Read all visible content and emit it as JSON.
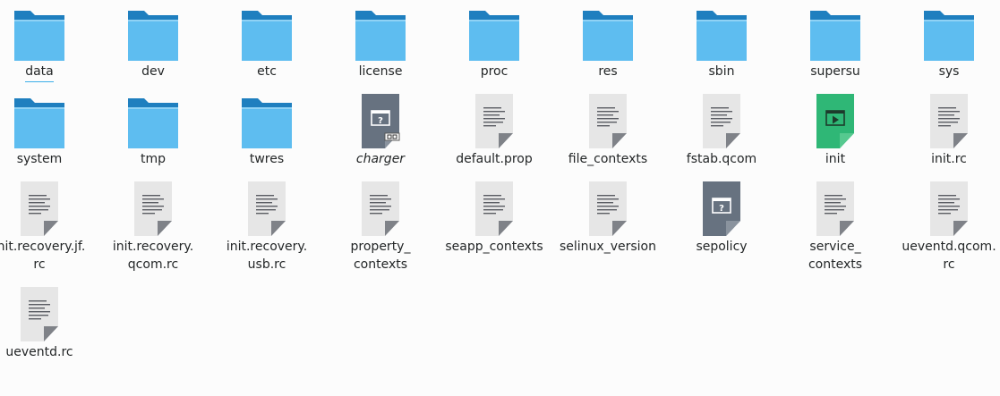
{
  "colors": {
    "folder_front": "#5ebdf0",
    "folder_back": "#1f7fbf",
    "doc_fill": "#e6e6e6",
    "doc_fold": "#7f8288",
    "doc_lines": "#5a5d63",
    "unknown_fill": "#677280",
    "exec_fill": "#2fb776",
    "selection_underline": "#3daee9"
  },
  "items": [
    {
      "name": "data",
      "lines": [
        "data"
      ],
      "icon": "folder-icon",
      "selected": true
    },
    {
      "name": "dev",
      "lines": [
        "dev"
      ],
      "icon": "folder-icon"
    },
    {
      "name": "etc",
      "lines": [
        "etc"
      ],
      "icon": "folder-icon"
    },
    {
      "name": "license",
      "lines": [
        "license"
      ],
      "icon": "folder-icon"
    },
    {
      "name": "proc",
      "lines": [
        "proc"
      ],
      "icon": "folder-icon"
    },
    {
      "name": "res",
      "lines": [
        "res"
      ],
      "icon": "folder-icon"
    },
    {
      "name": "sbin",
      "lines": [
        "sbin"
      ],
      "icon": "folder-icon"
    },
    {
      "name": "supersu",
      "lines": [
        "supersu"
      ],
      "icon": "folder-icon"
    },
    {
      "name": "sys",
      "lines": [
        "sys"
      ],
      "icon": "folder-icon"
    },
    {
      "name": "system",
      "lines": [
        "system"
      ],
      "icon": "folder-icon"
    },
    {
      "name": "tmp",
      "lines": [
        "tmp"
      ],
      "icon": "folder-icon"
    },
    {
      "name": "twres",
      "lines": [
        "twres"
      ],
      "icon": "folder-icon"
    },
    {
      "name": "charger",
      "lines": [
        "charger"
      ],
      "icon": "unknown-file-link-icon",
      "italic": true
    },
    {
      "name": "default.prop",
      "lines": [
        "default.prop"
      ],
      "icon": "text-file-icon"
    },
    {
      "name": "file_contexts",
      "lines": [
        "file_contexts"
      ],
      "icon": "text-file-icon"
    },
    {
      "name": "fstab.qcom",
      "lines": [
        "fstab.qcom"
      ],
      "icon": "text-file-icon"
    },
    {
      "name": "init",
      "lines": [
        "init"
      ],
      "icon": "executable-icon"
    },
    {
      "name": "init.rc",
      "lines": [
        "init.rc"
      ],
      "icon": "text-file-icon"
    },
    {
      "name": "init.recovery.jf.rc",
      "lines": [
        "init.recovery.jf.",
        "rc"
      ],
      "icon": "text-file-icon"
    },
    {
      "name": "init.recovery.qcom.rc",
      "lines": [
        "init.recovery.",
        "qcom.rc"
      ],
      "icon": "text-file-icon"
    },
    {
      "name": "init.recovery.usb.rc",
      "lines": [
        "init.recovery.",
        "usb.rc"
      ],
      "icon": "text-file-icon"
    },
    {
      "name": "property_contexts",
      "lines": [
        "property_",
        "contexts"
      ],
      "icon": "text-file-icon"
    },
    {
      "name": "seapp_contexts",
      "lines": [
        "seapp_contexts"
      ],
      "icon": "text-file-icon"
    },
    {
      "name": "selinux_version",
      "lines": [
        "selinux_version"
      ],
      "icon": "text-file-icon"
    },
    {
      "name": "sepolicy",
      "lines": [
        "sepolicy"
      ],
      "icon": "unknown-file-icon"
    },
    {
      "name": "service_contexts",
      "lines": [
        "service_",
        "contexts"
      ],
      "icon": "text-file-icon"
    },
    {
      "name": "ueventd.qcom.rc",
      "lines": [
        "ueventd.qcom.",
        "rc"
      ],
      "icon": "text-file-icon"
    },
    {
      "name": "ueventd.rc",
      "lines": [
        "ueventd.rc"
      ],
      "icon": "text-file-icon"
    }
  ]
}
